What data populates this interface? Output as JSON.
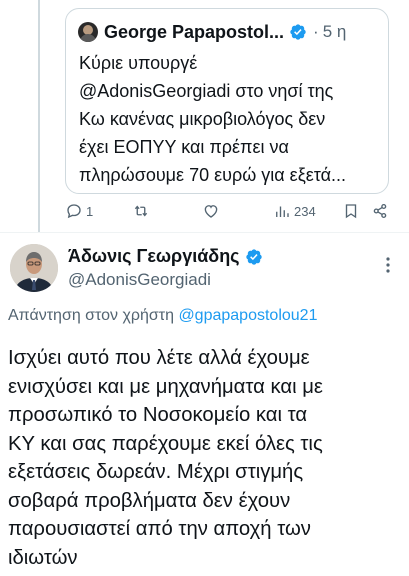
{
  "quoted_tweet": {
    "author_name": "George Papapostol...",
    "time_separator": "·",
    "time": "5 η",
    "text": "Κύριε υπουργέ\n@AdonisGeorgiadi στο νησί της\nΚω κανένας μικροβιολόγος δεν\nέχει ΕΟΠΥΥ και πρέπει να\nπληρώσουμε 70 ευρώ για εξετά..."
  },
  "actions": {
    "replies": "1",
    "retweets": "",
    "likes": "",
    "views": "234"
  },
  "reply": {
    "author_name": "Άδωνις Γεωργιάδης",
    "handle": "@AdonisGeorgiadi",
    "reply_to_prefix": "Απάντηση στον χρήστη",
    "reply_to_handle": "@gpapapostolou21",
    "text": "Ισχύει αυτό που λέτε αλλά έχουμε\nενισχύσει και με μηχανήματα και με\nπροσωπικό το Νοσοκομείο και τα\nΚΥ και σας παρέχουμε εκεί όλες τις\nεξετάσεις δωρεάν. Μέχρι στιγμής\nσοβαρά προβλήματα δεν έχουν\nπαρουσιαστεί από την αποχή των\nιδιωτών"
  },
  "colors": {
    "verified_blue": "#1d9bf0",
    "secondary_text": "#536471",
    "border": "#cfd9de"
  },
  "icons": {
    "reply": "reply-icon",
    "retweet": "retweet-icon",
    "like": "heart-icon",
    "views": "views-chart-icon",
    "bookmark": "bookmark-icon",
    "share": "share-icon",
    "verified": "verified-badge-icon",
    "more": "more-options-icon"
  }
}
